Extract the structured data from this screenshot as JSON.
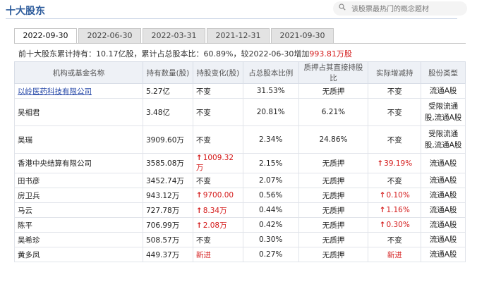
{
  "header": {
    "title": "十大股东",
    "search_placeholder": "该股票最热门的概念题材"
  },
  "tabs": [
    {
      "label": "2022-09-30",
      "active": true
    },
    {
      "label": "2022-06-30",
      "active": false
    },
    {
      "label": "2022-03-31",
      "active": false
    },
    {
      "label": "2021-12-31",
      "active": false
    },
    {
      "label": "2021-09-30",
      "active": false
    }
  ],
  "summary": {
    "prefix": "前十大股东累计持有：",
    "held": "10.17亿股",
    "mid": "，累计占总股本比：",
    "ratio": "60.89%",
    "compare": "，较2022-06-30增加",
    "change": "993.81万股"
  },
  "table": {
    "headers": [
      "机构或基金名称",
      "持有数量(股)",
      "持股变化(股)",
      "占总股本比例",
      "质押占其直接持股比",
      "实际增减持",
      "股份类型"
    ],
    "rows": [
      {
        "name": "以岭医药科技有限公司",
        "link": true,
        "qty": "5.27亿",
        "change": "不变",
        "change_up": false,
        "ratio": "31.53%",
        "pledge": "无质押",
        "actual": "不变",
        "actual_up": false,
        "type": "流通A股",
        "tall": false
      },
      {
        "name": "吴相君",
        "link": false,
        "qty": "3.48亿",
        "change": "不变",
        "change_up": false,
        "ratio": "20.81%",
        "pledge": "6.21%",
        "actual": "不变",
        "actual_up": false,
        "type": "受限流通股,流通A股",
        "tall": true
      },
      {
        "name": "吴瑞",
        "link": false,
        "qty": "3909.60万",
        "change": "不变",
        "change_up": false,
        "ratio": "2.34%",
        "pledge": "24.86%",
        "actual": "不变",
        "actual_up": false,
        "type": "受限流通股,流通A股",
        "tall": true
      },
      {
        "name": "香港中央结算有限公司",
        "link": false,
        "qty": "3585.08万",
        "change": "1009.32万",
        "change_up": true,
        "ratio": "2.15%",
        "pledge": "无质押",
        "actual": "39.19%",
        "actual_up": true,
        "type": "流通A股",
        "tall": false
      },
      {
        "name": "田书彦",
        "link": false,
        "qty": "3452.74万",
        "change": "不变",
        "change_up": false,
        "ratio": "2.07%",
        "pledge": "无质押",
        "actual": "不变",
        "actual_up": false,
        "type": "流通A股",
        "tall": false
      },
      {
        "name": "房卫兵",
        "link": false,
        "qty": "943.12万",
        "change": "9700.00",
        "change_up": true,
        "ratio": "0.56%",
        "pledge": "无质押",
        "actual": "0.10%",
        "actual_up": true,
        "type": "流通A股",
        "tall": false
      },
      {
        "name": "马云",
        "link": false,
        "qty": "727.78万",
        "change": "8.34万",
        "change_up": true,
        "ratio": "0.44%",
        "pledge": "无质押",
        "actual": "1.16%",
        "actual_up": true,
        "type": "流通A股",
        "tall": false
      },
      {
        "name": "陈平",
        "link": false,
        "qty": "706.99万",
        "change": "2.08万",
        "change_up": true,
        "ratio": "0.42%",
        "pledge": "无质押",
        "actual": "0.30%",
        "actual_up": true,
        "type": "流通A股",
        "tall": false
      },
      {
        "name": "吴希珍",
        "link": false,
        "qty": "508.57万",
        "change": "不变",
        "change_up": false,
        "ratio": "0.30%",
        "pledge": "无质押",
        "actual": "不变",
        "actual_up": false,
        "type": "流通A股",
        "tall": false
      },
      {
        "name": "黄多凤",
        "link": false,
        "qty": "449.37万",
        "change": "新进",
        "change_up": false,
        "change_red": true,
        "ratio": "0.27%",
        "pledge": "无质押",
        "actual": "新进",
        "actual_up": false,
        "actual_red": true,
        "type": "流通A股",
        "tall": false
      }
    ]
  },
  "colors": {
    "up": "#d41b1b",
    "link": "#2749a8",
    "title": "#2b5a9b"
  }
}
